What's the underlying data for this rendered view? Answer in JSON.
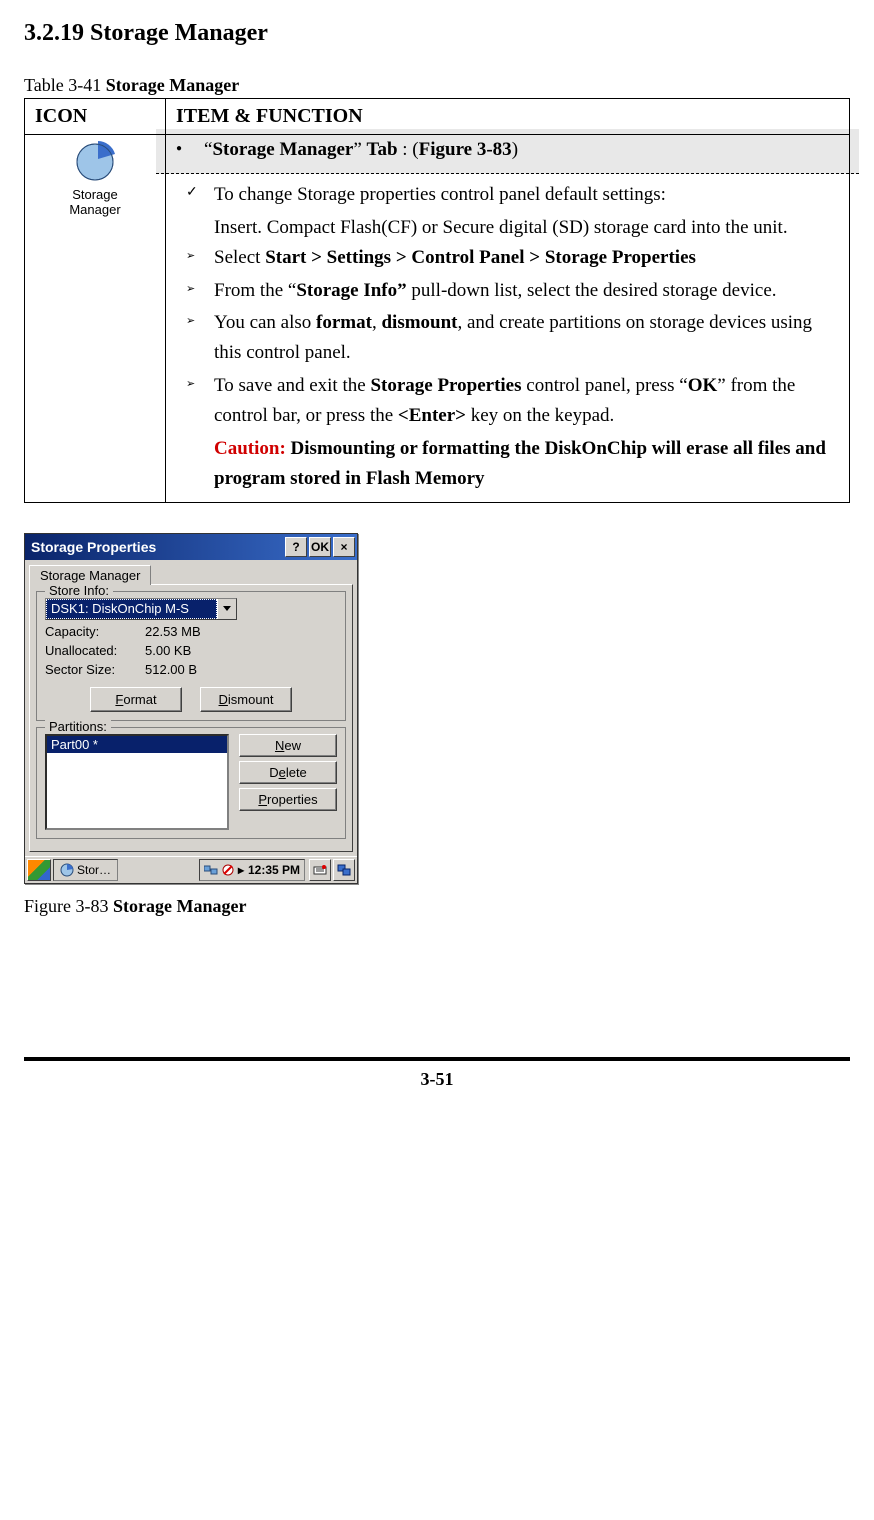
{
  "section_heading": "3.2.19 Storage Manager",
  "table_caption_prefix": "Table 3-41 ",
  "table_caption_bold": "Storage Manager",
  "table": {
    "header_icon": "ICON",
    "header_item": "ITEM & FUNCTION",
    "icon_label_line1": "Storage",
    "icon_label_line2": "Manager",
    "tab_line_prefix": "“",
    "tab_line_bold1": "Storage Manager",
    "tab_line_mid": "” ",
    "tab_line_bold2": "Tab",
    "tab_line_colon": " : (",
    "tab_line_bold3": "Figure 3-83",
    "tab_line_suffix": ")",
    "check_line": "To change Storage properties control panel default settings:",
    "check_sub": "Insert. Compact Flash(CF) or Secure digital (SD) storage card into the unit.",
    "arrow1_a": "Select ",
    "arrow1_b": "Start > Settings > Control Panel > Storage Properties",
    "arrow2_a": "From the “",
    "arrow2_b": "Storage Info”",
    "arrow2_c": " pull-down list, select the desired storage device.",
    "arrow3_a": "You can also ",
    "arrow3_b": "format",
    "arrow3_c": ", ",
    "arrow3_d": "dismount",
    "arrow3_e": ", and create partitions on storage devices using this control panel.",
    "arrow4_a": "To save and exit the ",
    "arrow4_b": "Storage Properties",
    "arrow4_c": " control panel, press “",
    "arrow4_d": "OK",
    "arrow4_e": "” from the control bar, or press the ",
    "arrow4_f": "<Enter>",
    "arrow4_g": " key on the keypad.",
    "caution_red": "Caution:",
    "caution_rest": " Dismounting or formatting the DiskOnChip will erase all files and program stored in Flash Memory"
  },
  "dialog": {
    "title": "Storage Properties",
    "btn_help": "?",
    "btn_ok": "OK",
    "btn_close": "×",
    "tab": "Storage Manager",
    "store_info_legend": "Store Info:",
    "select_value": "DSK1: DiskOnChip M-S",
    "capacity_label": "Capacity:",
    "capacity_value": "22.53 MB",
    "unalloc_label": "Unallocated:",
    "unalloc_value": "5.00 KB",
    "sector_label": "Sector Size:",
    "sector_value": "512.00 B",
    "format_btn": "Format",
    "dismount_btn": "Dismount",
    "partitions_legend": "Partitions:",
    "part_item": "Part00 *",
    "new_btn": "New",
    "delete_btn": "Delete",
    "properties_btn": "Properties",
    "task_label": "Stor…",
    "tray_time": "12:35 PM"
  },
  "figure_caption_prefix": "Figure 3-83 ",
  "figure_caption_bold": "Storage Manager",
  "page_number": "3-51"
}
